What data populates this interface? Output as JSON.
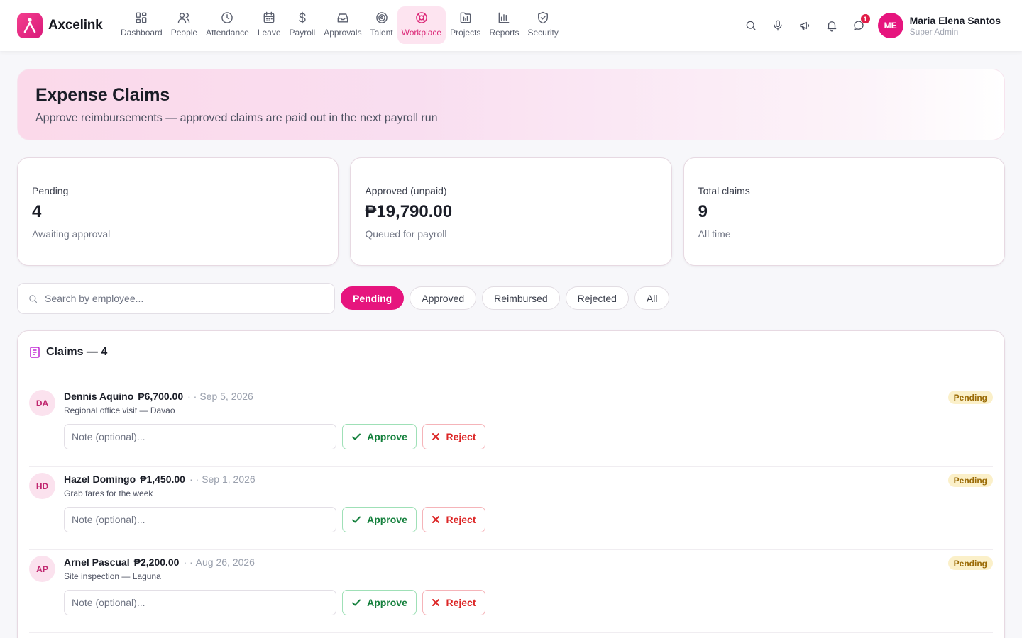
{
  "brand": {
    "name": "Axcelink",
    "logo_icon": "person-a-logo",
    "accent": "#e6157e"
  },
  "nav": [
    {
      "label": "Dashboard",
      "icon": "grid-icon",
      "active": false
    },
    {
      "label": "People",
      "icon": "users-icon",
      "active": false
    },
    {
      "label": "Attendance",
      "icon": "clock-icon",
      "active": false
    },
    {
      "label": "Leave",
      "icon": "calendar-icon",
      "active": false
    },
    {
      "label": "Payroll",
      "icon": "dollar-icon",
      "active": false
    },
    {
      "label": "Approvals",
      "icon": "inbox-icon",
      "active": false
    },
    {
      "label": "Talent",
      "icon": "target-icon",
      "active": false
    },
    {
      "label": "Workplace",
      "icon": "lifebuoy-icon",
      "active": true
    },
    {
      "label": "Projects",
      "icon": "folder-icon",
      "active": false
    },
    {
      "label": "Reports",
      "icon": "bar-chart-icon",
      "active": false
    },
    {
      "label": "Security",
      "icon": "shield-icon",
      "active": false
    }
  ],
  "header": {
    "tools": [
      "search-icon",
      "microphone-icon",
      "megaphone-icon",
      "bell-icon",
      "chat-icon"
    ],
    "chat_badge": "1",
    "user": {
      "initials": "ME",
      "name": "Maria Elena Santos",
      "role": "Super Admin"
    }
  },
  "hero": {
    "title": "Expense Claims",
    "subtitle": "Approve reimbursements — approved claims are paid out in the next payroll run"
  },
  "stats": [
    {
      "label": "Pending",
      "value": "4",
      "note": "Awaiting approval"
    },
    {
      "label": "Approved (unpaid)",
      "value": "₱19,790.00",
      "note": "Queued for payroll"
    },
    {
      "label": "Total claims",
      "value": "9",
      "note": "All time"
    }
  ],
  "filters": {
    "search_placeholder": "Search by employee...",
    "chips": [
      {
        "label": "Pending",
        "active": true
      },
      {
        "label": "Approved",
        "active": false
      },
      {
        "label": "Reimbursed",
        "active": false
      },
      {
        "label": "Rejected",
        "active": false
      },
      {
        "label": "All",
        "active": false
      }
    ]
  },
  "claims_panel": {
    "title": "Claims — 4",
    "note_placeholder": "Note (optional)...",
    "approve_label": "Approve",
    "reject_label": "Reject",
    "items": [
      {
        "initials": "DA",
        "name": "Dennis Aquino",
        "amount": "₱6,700.00",
        "sep": "· ·",
        "date": "Sep 5, 2026",
        "description": "Regional office visit — Davao",
        "status": "Pending"
      },
      {
        "initials": "HD",
        "name": "Hazel Domingo",
        "amount": "₱1,450.00",
        "sep": "· ·",
        "date": "Sep 1, 2026",
        "description": "Grab fares for the week",
        "status": "Pending"
      },
      {
        "initials": "AP",
        "name": "Arnel Pascual",
        "amount": "₱2,200.00",
        "sep": "· ·",
        "date": "Aug 26, 2026",
        "description": "Site inspection — Laguna",
        "status": "Pending"
      }
    ]
  }
}
